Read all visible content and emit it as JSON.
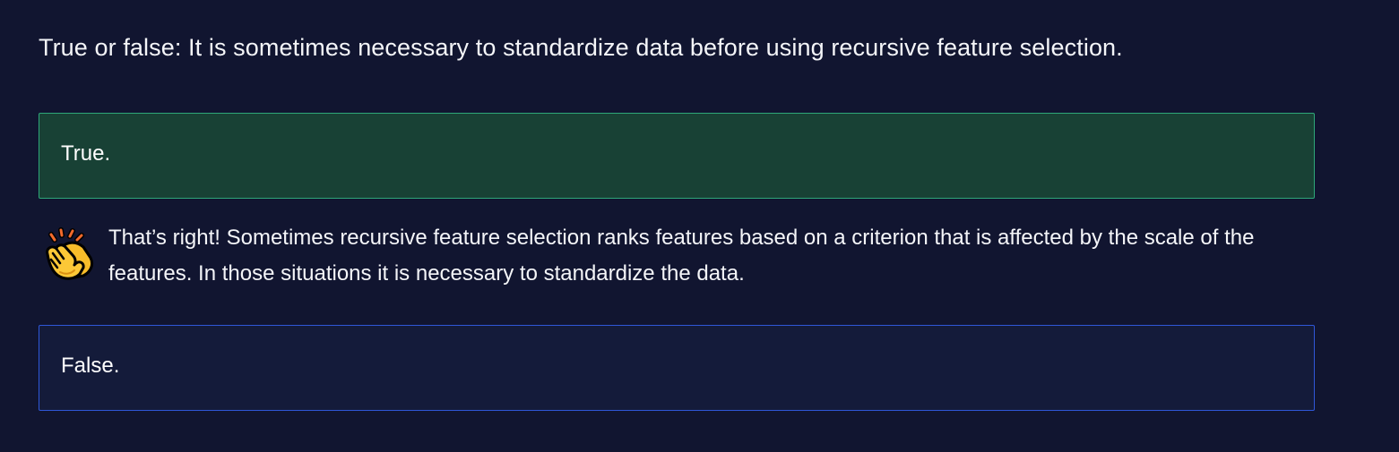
{
  "question": {
    "text": "True or false: It is sometimes necessary to standardize data before using recursive feature selection."
  },
  "options": [
    {
      "label": "True.",
      "state": "correct"
    },
    {
      "label": "False.",
      "state": "unselected"
    }
  ],
  "feedback": {
    "icon": "clapping-hands-icon",
    "text": "That’s right! Sometimes recursive feature selection ranks features based on a criterion that is affected by the scale of the features. In those situations it is necessary to standardize the data."
  },
  "colors": {
    "background": "#111530",
    "correct_fill": "#184135",
    "correct_border": "#2ea779",
    "neutral_fill": "#141b3a",
    "neutral_border": "#2f57d8"
  }
}
